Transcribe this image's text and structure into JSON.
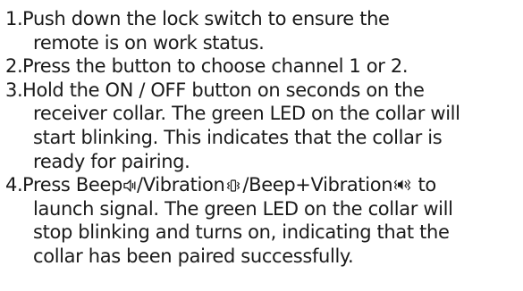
{
  "steps": [
    {
      "number": "1.",
      "lines": [
        "Push down the lock switch to ensure the",
        "remote is on work status."
      ]
    },
    {
      "number": "2.",
      "lines": [
        "Press the button to choose channel 1 or 2."
      ]
    },
    {
      "number": "3.",
      "lines": [
        "Hold the ON / OFF button on seconds on the",
        "receiver collar.  The green LED on the collar will",
        "start blinking.  This indicates that the collar is",
        "ready for pairing."
      ]
    },
    {
      "number": "4.",
      "line1": {
        "a": "Press Beep",
        "b": "/Vibration",
        "c": "/Beep+Vibration",
        "d": " to"
      },
      "lines": [
        "launch signal. The green LED on the collar will",
        "stop blinking and turns on, indicating that the",
        "collar has been paired successfully."
      ]
    }
  ],
  "icons": {
    "beep": "speaker-icon",
    "vibration": "vibration-icon",
    "beep_vibration": "beep-vibration-icon"
  },
  "colors": {
    "text": "#1a1a1a",
    "background": "#ffffff"
  }
}
